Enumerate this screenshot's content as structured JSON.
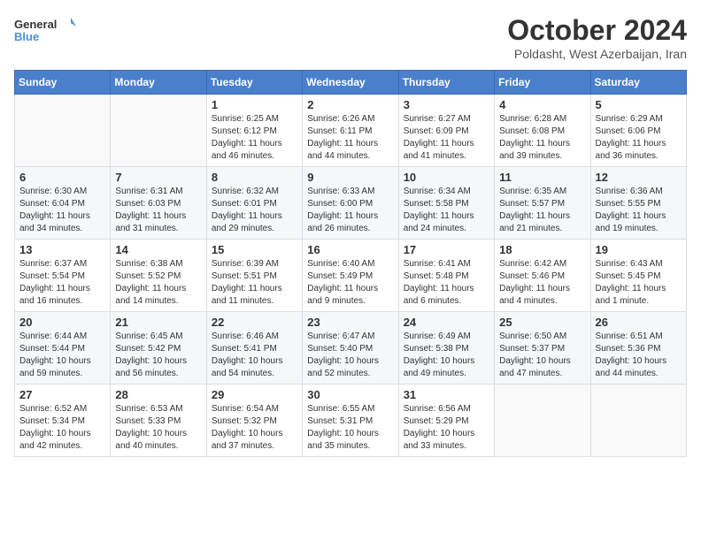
{
  "header": {
    "logo_general": "General",
    "logo_blue": "Blue",
    "month_title": "October 2024",
    "subtitle": "Poldasht, West Azerbaijan, Iran"
  },
  "columns": [
    "Sunday",
    "Monday",
    "Tuesday",
    "Wednesday",
    "Thursday",
    "Friday",
    "Saturday"
  ],
  "weeks": [
    [
      {
        "day": "",
        "info": ""
      },
      {
        "day": "",
        "info": ""
      },
      {
        "day": "1",
        "sunrise": "6:25 AM",
        "sunset": "6:12 PM",
        "daylight": "11 hours and 46 minutes."
      },
      {
        "day": "2",
        "sunrise": "6:26 AM",
        "sunset": "6:11 PM",
        "daylight": "11 hours and 44 minutes."
      },
      {
        "day": "3",
        "sunrise": "6:27 AM",
        "sunset": "6:09 PM",
        "daylight": "11 hours and 41 minutes."
      },
      {
        "day": "4",
        "sunrise": "6:28 AM",
        "sunset": "6:08 PM",
        "daylight": "11 hours and 39 minutes."
      },
      {
        "day": "5",
        "sunrise": "6:29 AM",
        "sunset": "6:06 PM",
        "daylight": "11 hours and 36 minutes."
      }
    ],
    [
      {
        "day": "6",
        "sunrise": "6:30 AM",
        "sunset": "6:04 PM",
        "daylight": "11 hours and 34 minutes."
      },
      {
        "day": "7",
        "sunrise": "6:31 AM",
        "sunset": "6:03 PM",
        "daylight": "11 hours and 31 minutes."
      },
      {
        "day": "8",
        "sunrise": "6:32 AM",
        "sunset": "6:01 PM",
        "daylight": "11 hours and 29 minutes."
      },
      {
        "day": "9",
        "sunrise": "6:33 AM",
        "sunset": "6:00 PM",
        "daylight": "11 hours and 26 minutes."
      },
      {
        "day": "10",
        "sunrise": "6:34 AM",
        "sunset": "5:58 PM",
        "daylight": "11 hours and 24 minutes."
      },
      {
        "day": "11",
        "sunrise": "6:35 AM",
        "sunset": "5:57 PM",
        "daylight": "11 hours and 21 minutes."
      },
      {
        "day": "12",
        "sunrise": "6:36 AM",
        "sunset": "5:55 PM",
        "daylight": "11 hours and 19 minutes."
      }
    ],
    [
      {
        "day": "13",
        "sunrise": "6:37 AM",
        "sunset": "5:54 PM",
        "daylight": "11 hours and 16 minutes."
      },
      {
        "day": "14",
        "sunrise": "6:38 AM",
        "sunset": "5:52 PM",
        "daylight": "11 hours and 14 minutes."
      },
      {
        "day": "15",
        "sunrise": "6:39 AM",
        "sunset": "5:51 PM",
        "daylight": "11 hours and 11 minutes."
      },
      {
        "day": "16",
        "sunrise": "6:40 AM",
        "sunset": "5:49 PM",
        "daylight": "11 hours and 9 minutes."
      },
      {
        "day": "17",
        "sunrise": "6:41 AM",
        "sunset": "5:48 PM",
        "daylight": "11 hours and 6 minutes."
      },
      {
        "day": "18",
        "sunrise": "6:42 AM",
        "sunset": "5:46 PM",
        "daylight": "11 hours and 4 minutes."
      },
      {
        "day": "19",
        "sunrise": "6:43 AM",
        "sunset": "5:45 PM",
        "daylight": "11 hours and 1 minute."
      }
    ],
    [
      {
        "day": "20",
        "sunrise": "6:44 AM",
        "sunset": "5:44 PM",
        "daylight": "10 hours and 59 minutes."
      },
      {
        "day": "21",
        "sunrise": "6:45 AM",
        "sunset": "5:42 PM",
        "daylight": "10 hours and 56 minutes."
      },
      {
        "day": "22",
        "sunrise": "6:46 AM",
        "sunset": "5:41 PM",
        "daylight": "10 hours and 54 minutes."
      },
      {
        "day": "23",
        "sunrise": "6:47 AM",
        "sunset": "5:40 PM",
        "daylight": "10 hours and 52 minutes."
      },
      {
        "day": "24",
        "sunrise": "6:49 AM",
        "sunset": "5:38 PM",
        "daylight": "10 hours and 49 minutes."
      },
      {
        "day": "25",
        "sunrise": "6:50 AM",
        "sunset": "5:37 PM",
        "daylight": "10 hours and 47 minutes."
      },
      {
        "day": "26",
        "sunrise": "6:51 AM",
        "sunset": "5:36 PM",
        "daylight": "10 hours and 44 minutes."
      }
    ],
    [
      {
        "day": "27",
        "sunrise": "6:52 AM",
        "sunset": "5:34 PM",
        "daylight": "10 hours and 42 minutes."
      },
      {
        "day": "28",
        "sunrise": "6:53 AM",
        "sunset": "5:33 PM",
        "daylight": "10 hours and 40 minutes."
      },
      {
        "day": "29",
        "sunrise": "6:54 AM",
        "sunset": "5:32 PM",
        "daylight": "10 hours and 37 minutes."
      },
      {
        "day": "30",
        "sunrise": "6:55 AM",
        "sunset": "5:31 PM",
        "daylight": "10 hours and 35 minutes."
      },
      {
        "day": "31",
        "sunrise": "6:56 AM",
        "sunset": "5:29 PM",
        "daylight": "10 hours and 33 minutes."
      },
      {
        "day": "",
        "info": ""
      },
      {
        "day": "",
        "info": ""
      }
    ]
  ]
}
